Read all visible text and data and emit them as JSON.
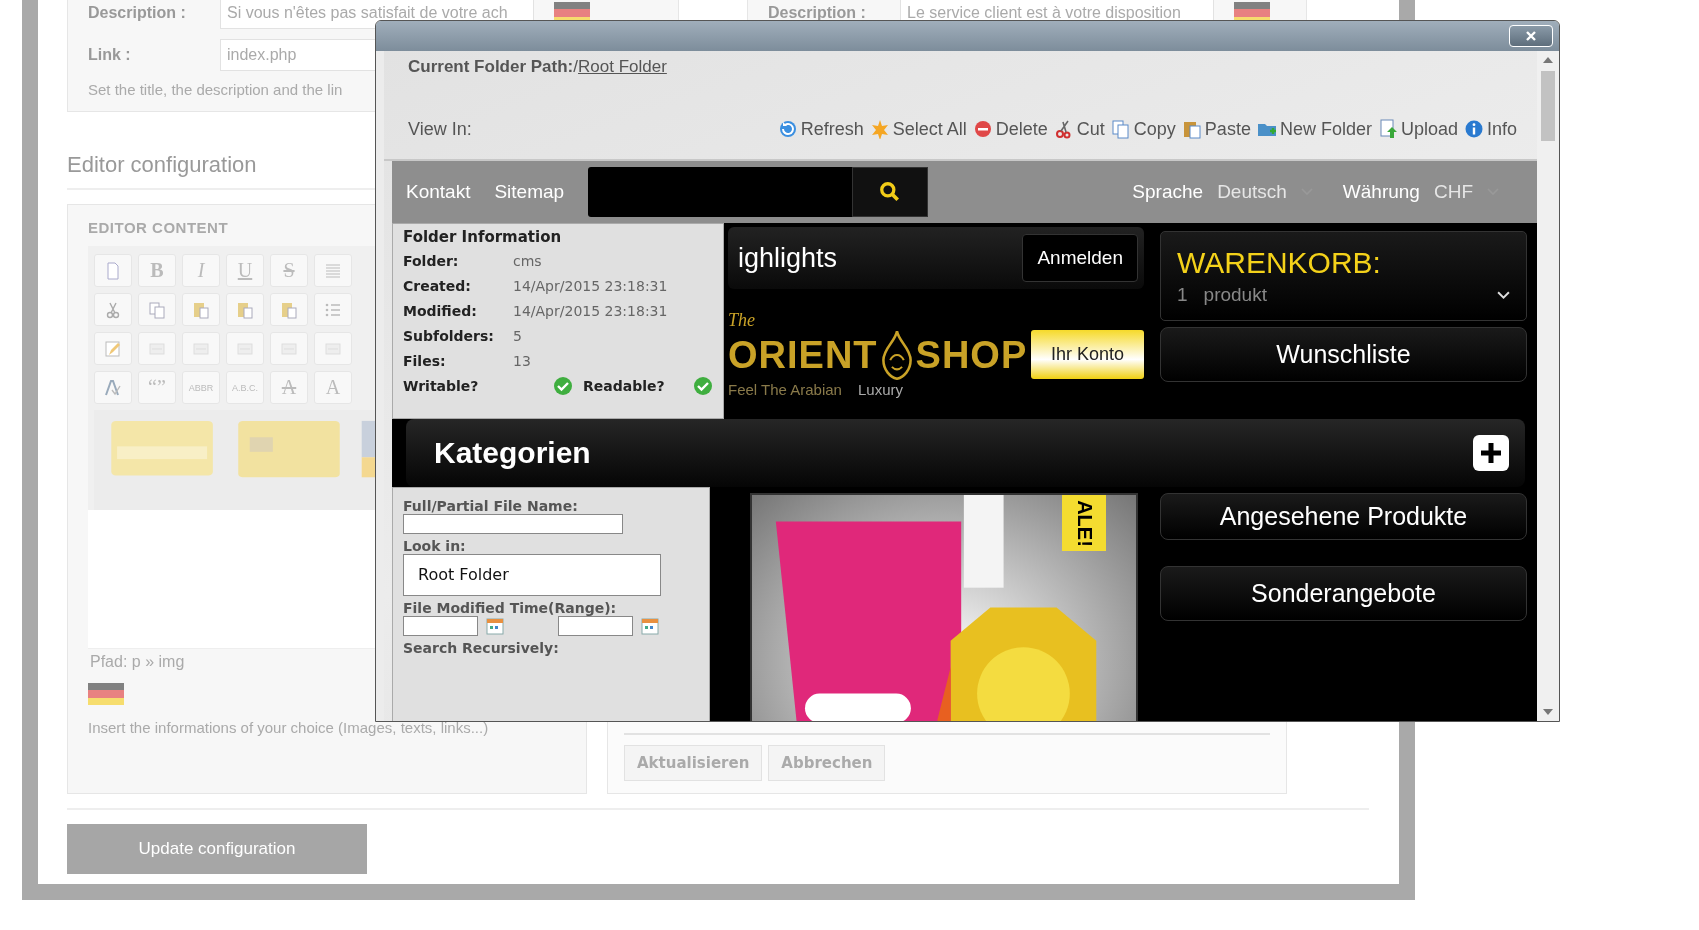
{
  "page": {
    "top_left": {
      "description_label": "Description :",
      "description_value": "Si vous n'êtes pas satisfait de votre ach",
      "link_label": "Link :",
      "link_value": "index.php",
      "hint": "Set the title, the description and the lin"
    },
    "top_right": {
      "description_label": "Description :",
      "description_value": "Le service client est à votre disposition"
    },
    "editor_heading": "Editor configuration",
    "editor_content_title": "EDITOR CONTENT",
    "editor_toolbar": [
      [
        {
          "kind": "page"
        },
        {
          "kind": "bold",
          "label": "B"
        },
        {
          "kind": "italic",
          "label": "I"
        },
        {
          "kind": "underline",
          "label": "U"
        },
        {
          "kind": "strike",
          "label": "S"
        },
        {
          "kind": "align"
        }
      ],
      [
        {
          "kind": "cut"
        },
        {
          "kind": "copy"
        },
        {
          "kind": "paste"
        },
        {
          "kind": "paste"
        },
        {
          "kind": "paste"
        },
        {
          "kind": "list"
        }
      ],
      [
        {
          "kind": "pencil"
        },
        {
          "kind": "blank"
        },
        {
          "kind": "blank"
        },
        {
          "kind": "blank"
        },
        {
          "kind": "blank"
        },
        {
          "kind": "blank"
        }
      ],
      [
        {
          "kind": "spell"
        },
        {
          "kind": "plain",
          "label": "“”"
        },
        {
          "kind": "small",
          "label": "ABBR"
        },
        {
          "kind": "small",
          "label": "A.B.C."
        },
        {
          "kind": "strike",
          "label": "A"
        },
        {
          "kind": "plain",
          "label": "A"
        }
      ]
    ],
    "path": "Pfad: p » img",
    "insert_hint": "Insert the informations of your choice (Images, texts, links...)",
    "right_buttons": [
      "Aktualisieren",
      "Abbrechen"
    ],
    "update_button": "Update configuration"
  },
  "dialog": {
    "current_path_label": "Current Folder Path:",
    "current_path_prefix": "/",
    "current_path_link": "Root Folder",
    "view_in_label": "View In:",
    "toolbar": [
      {
        "kind": "refresh",
        "label": "Refresh"
      },
      {
        "kind": "select_all",
        "label": "Select All"
      },
      {
        "kind": "delete",
        "label": "Delete"
      },
      {
        "kind": "cut",
        "label": "Cut"
      },
      {
        "kind": "copy",
        "label": "Copy"
      },
      {
        "kind": "paste",
        "label": "Paste"
      },
      {
        "kind": "new_folder",
        "label": "New Folder"
      },
      {
        "kind": "upload",
        "label": "Upload"
      },
      {
        "kind": "info",
        "label": "Info"
      }
    ],
    "folder_info": {
      "legend": "Folder Information",
      "rows": [
        {
          "label": "Folder:",
          "value": "cms"
        },
        {
          "label": "Created:",
          "value": "14/Apr/2015 23:18:31"
        },
        {
          "label": "Modified:",
          "value": "14/Apr/2015 23:18:31"
        },
        {
          "label": "Subfolders:",
          "value": "5"
        },
        {
          "label": "Files:",
          "value": "13"
        }
      ],
      "writable": {
        "label": "Writable?",
        "checked": true
      },
      "readable": {
        "label": "Readable?",
        "checked": true
      }
    },
    "search": {
      "name_label": "Full/Partial File Name:",
      "look_in_label": "Look in:",
      "look_in_value": "Root Folder",
      "time_label": "File Modified Time(Range):",
      "recursive_label": "Search Recursively:"
    },
    "shop": {
      "links": [
        "Kontakt",
        "Sitemap"
      ],
      "language_label": "Sprache",
      "language_value": "Deutsch",
      "currency_label": "Währung",
      "currency_value": "CHF",
      "highlights": "ighlights",
      "login_button": "Anmelden",
      "account_button": "Ihr Konto",
      "logo": {
        "the": "The",
        "orient": "ORIENT",
        "shop": "SHOP",
        "tagline": "Feel The Arabian",
        "luxury": "Luxury"
      },
      "sale_tag": "ALE!",
      "cart_title": "WARENKORB:",
      "cart_count": "1",
      "cart_unit": "produkt",
      "side_links": [
        "Wunschliste",
        "Angesehene Produkte",
        "Sonderangebote"
      ],
      "categories": "Kategorien"
    }
  }
}
